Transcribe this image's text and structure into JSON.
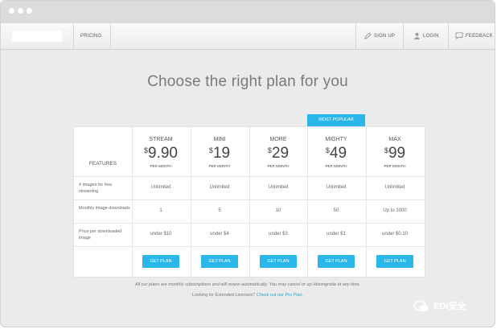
{
  "window": {
    "traffic_lights": [
      "close",
      "minimize",
      "maximize"
    ]
  },
  "nav": {
    "pricing": "PRICING",
    "signup": "SIGN UP",
    "login": "LOGIN",
    "feedback": "FEEDBACK",
    "icons": [
      "pencil-icon",
      "user-icon",
      "speech-bubble-icon"
    ]
  },
  "headline": "Choose the right plan for you",
  "badge": "MOST POPULAR",
  "table": {
    "features_label": "FEATURES",
    "row_labels": [
      "# images for free streaming",
      "Monthly image downloads",
      "Price per downloaded image"
    ],
    "plans": [
      {
        "name": "STREAM",
        "currency": "$",
        "amount": "9.90",
        "period": "PER MONTH",
        "streaming": "Unlimited",
        "downloads": "1",
        "price_per": "under $10",
        "cta": "GET PLAN"
      },
      {
        "name": "MINI",
        "currency": "$",
        "amount": "19",
        "period": "PER MONTH",
        "streaming": "Unlimited",
        "downloads": "5",
        "price_per": "under $4",
        "cta": "GET PLAN"
      },
      {
        "name": "MORE",
        "currency": "$",
        "amount": "29",
        "period": "PER MONTH",
        "streaming": "Unlimited",
        "downloads": "10",
        "price_per": "under $3",
        "cta": "GET PLAN"
      },
      {
        "name": "MIGHTY",
        "currency": "$",
        "amount": "49",
        "period": "PER MONTH",
        "streaming": "Unlimited",
        "downloads": "50",
        "price_per": "under $1",
        "cta": "GET PLAN"
      },
      {
        "name": "MAX",
        "currency": "$",
        "amount": "99",
        "period": "PER MONTH",
        "streaming": "Unlimited",
        "downloads": "Up to 1000",
        "price_per": "under $0.10",
        "cta": "GET PLAN"
      }
    ]
  },
  "footer": {
    "subscription_note": "All our plans are monthly subscriptions and will renew automatically. You may cancel or up-/downgrade at any time.",
    "licenses_question": "Looking for Extended Licenses?",
    "pro_link": "Check out our Pro Plan."
  },
  "watermark": {
    "text": "EDI安全",
    "icon": "wechat-icon"
  },
  "colors": {
    "accent": "#29b7ea",
    "background": "#ebebeb",
    "titlebar": "#dcdcdc"
  }
}
